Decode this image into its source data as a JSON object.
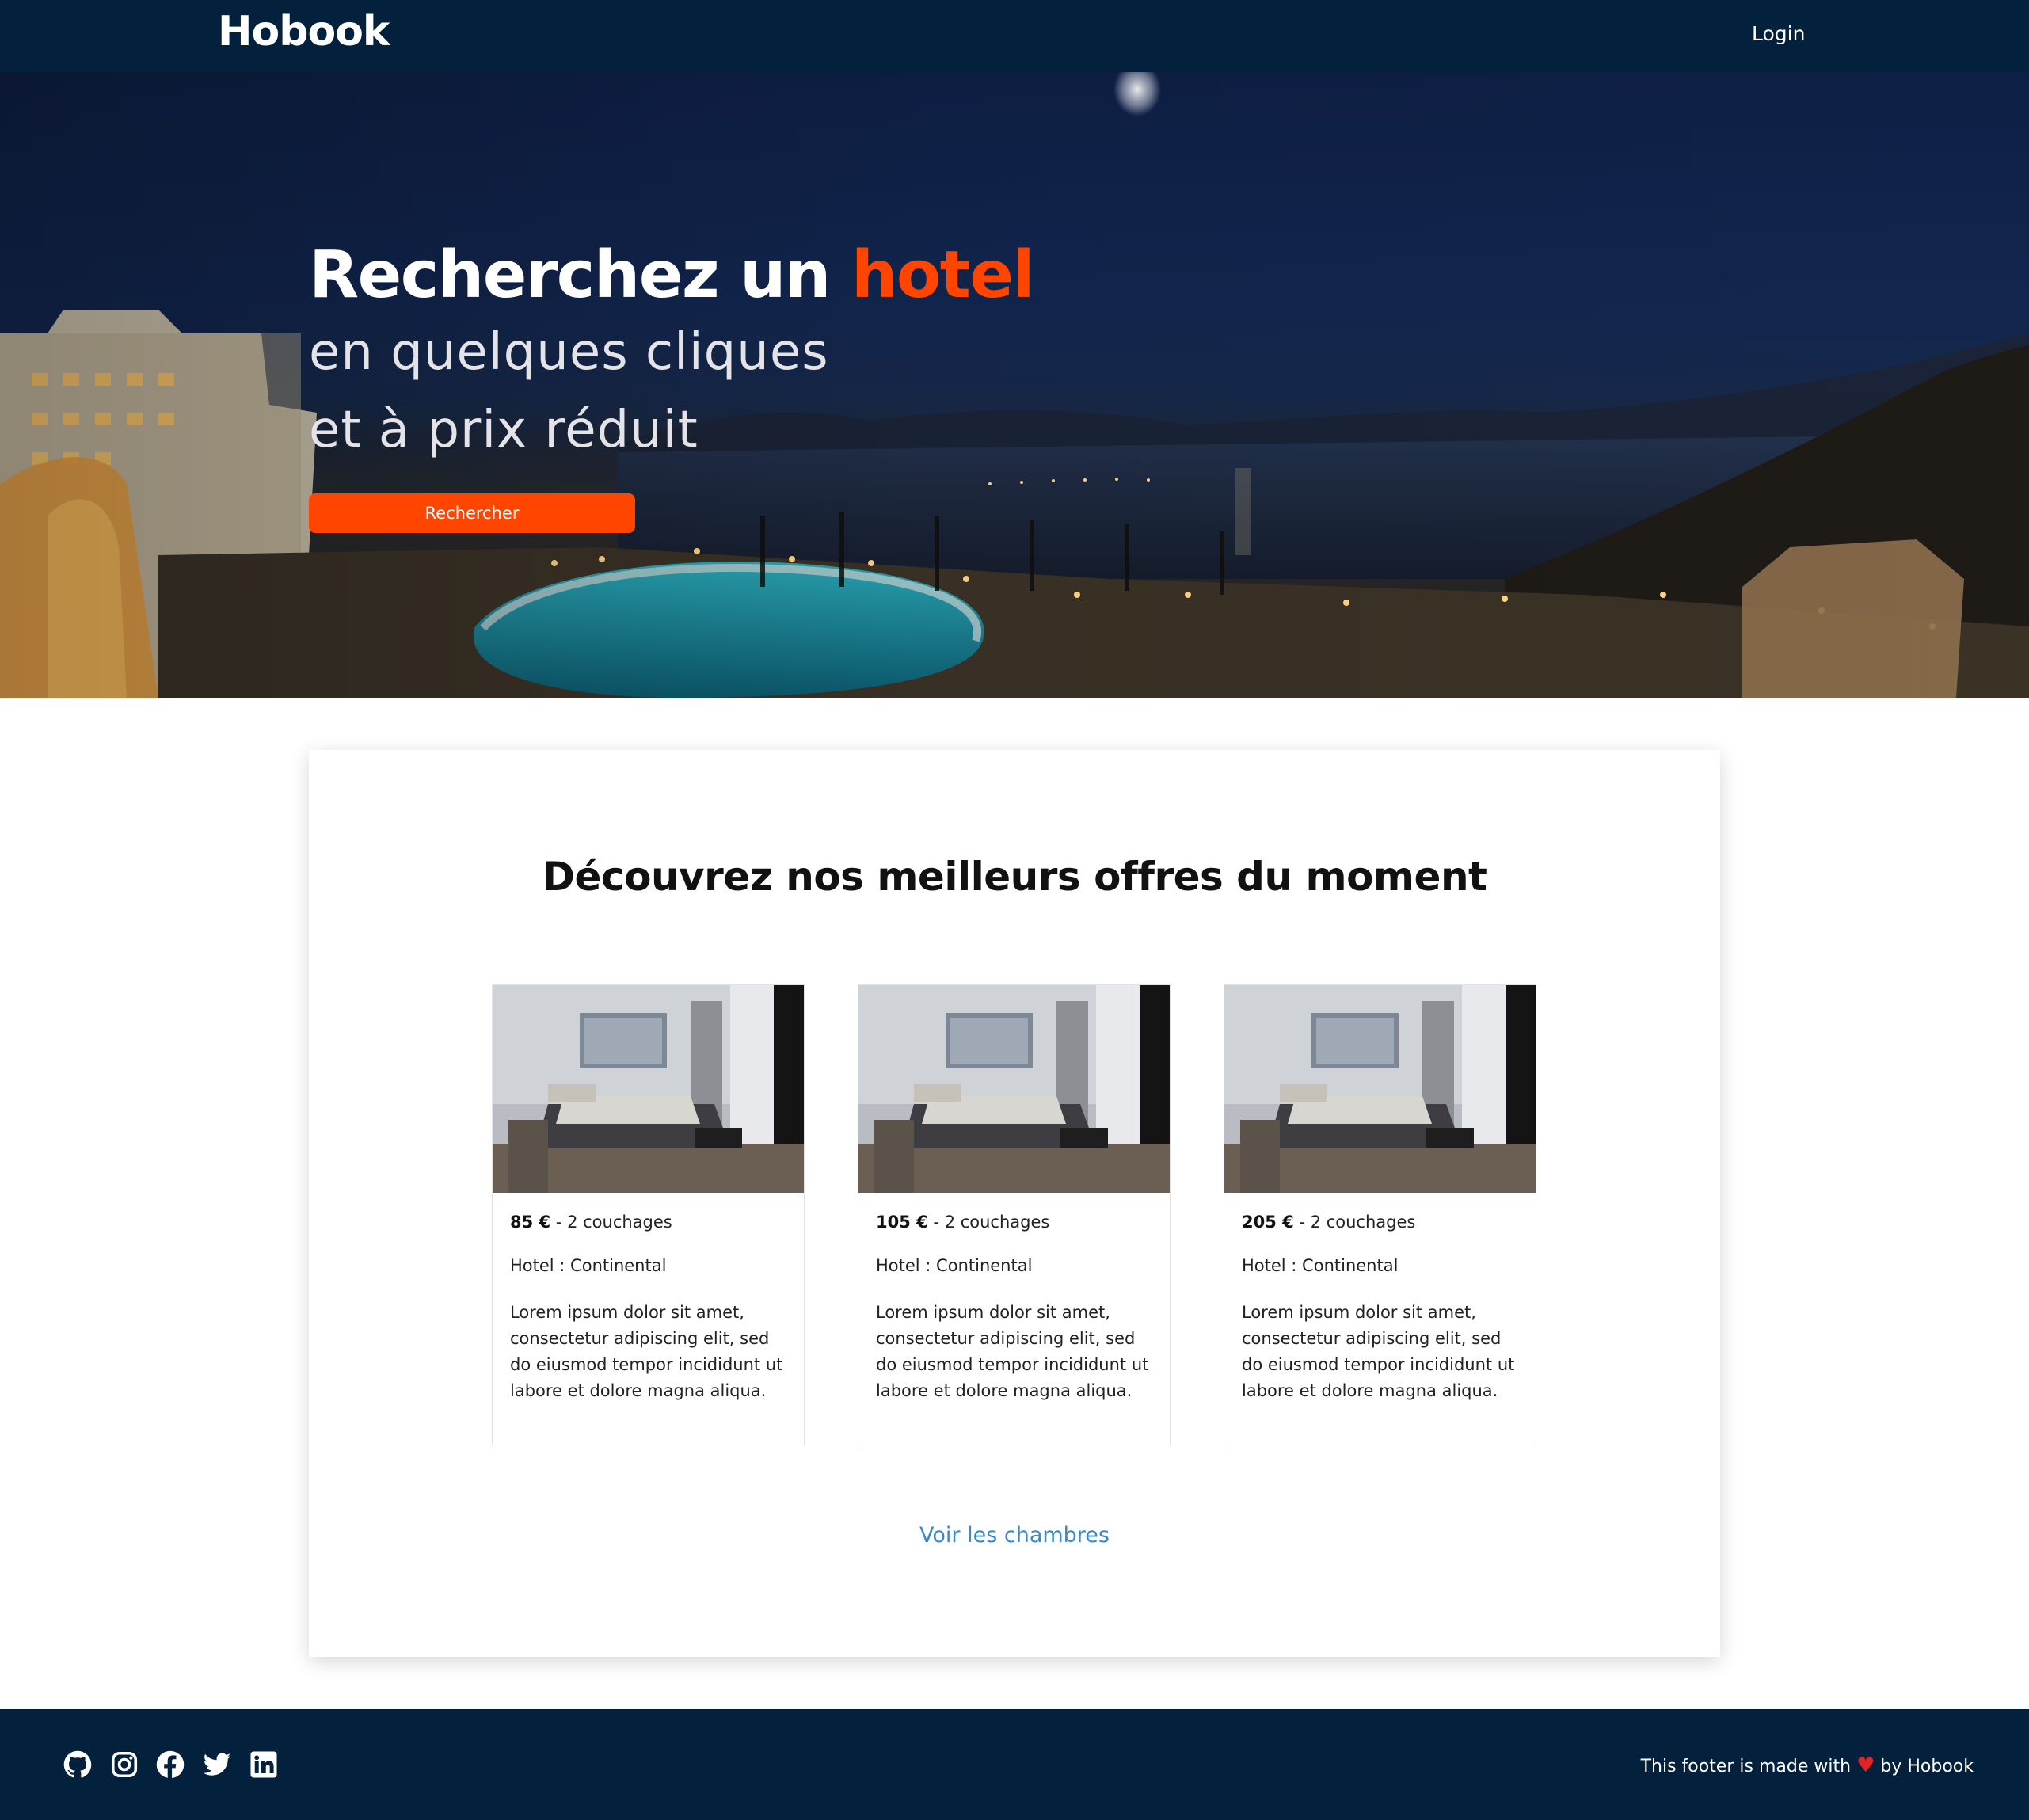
{
  "navbar": {
    "brand": "Hobook",
    "login_label": "Login"
  },
  "hero": {
    "title_main": "Recherchez un ",
    "title_accent": "hotel",
    "subtitle_line1": "en quelques cliques",
    "subtitle_line2": "et à prix réduit",
    "search_button": "Rechercher"
  },
  "offers": {
    "title": "Découvrez nos meilleurs offres du moment",
    "rooms": [
      {
        "price": "85 €",
        "beds": " - 2 couchages",
        "hotel": "Hotel : Continental",
        "description": "Lorem ipsum dolor sit amet, consectetur adipiscing elit, sed do eiusmod tempor incididunt ut labore et dolore magna aliqua."
      },
      {
        "price": "105 €",
        "beds": " - 2 couchages",
        "hotel": "Hotel : Continental",
        "description": "Lorem ipsum dolor sit amet, consectetur adipiscing elit, sed do eiusmod tempor incididunt ut labore et dolore magna aliqua."
      },
      {
        "price": "205 €",
        "beds": " - 2 couchages",
        "hotel": "Hotel : Continental",
        "description": "Lorem ipsum dolor sit amet, consectetur adipiscing elit, sed do eiusmod tempor incididunt ut labore et dolore magna aliqua."
      }
    ],
    "see_rooms_link": "Voir les chambres"
  },
  "footer": {
    "social_icons": [
      "github-icon",
      "instagram-icon",
      "facebook-icon",
      "twitter-icon",
      "linkedin-icon"
    ],
    "text_before": "This footer is made with ",
    "heart": "♥",
    "text_after": " by Hobook"
  },
  "colors": {
    "navy": "#03203c",
    "accent": "#ff4500",
    "link": "#3a87c9",
    "heart": "#e02424"
  }
}
